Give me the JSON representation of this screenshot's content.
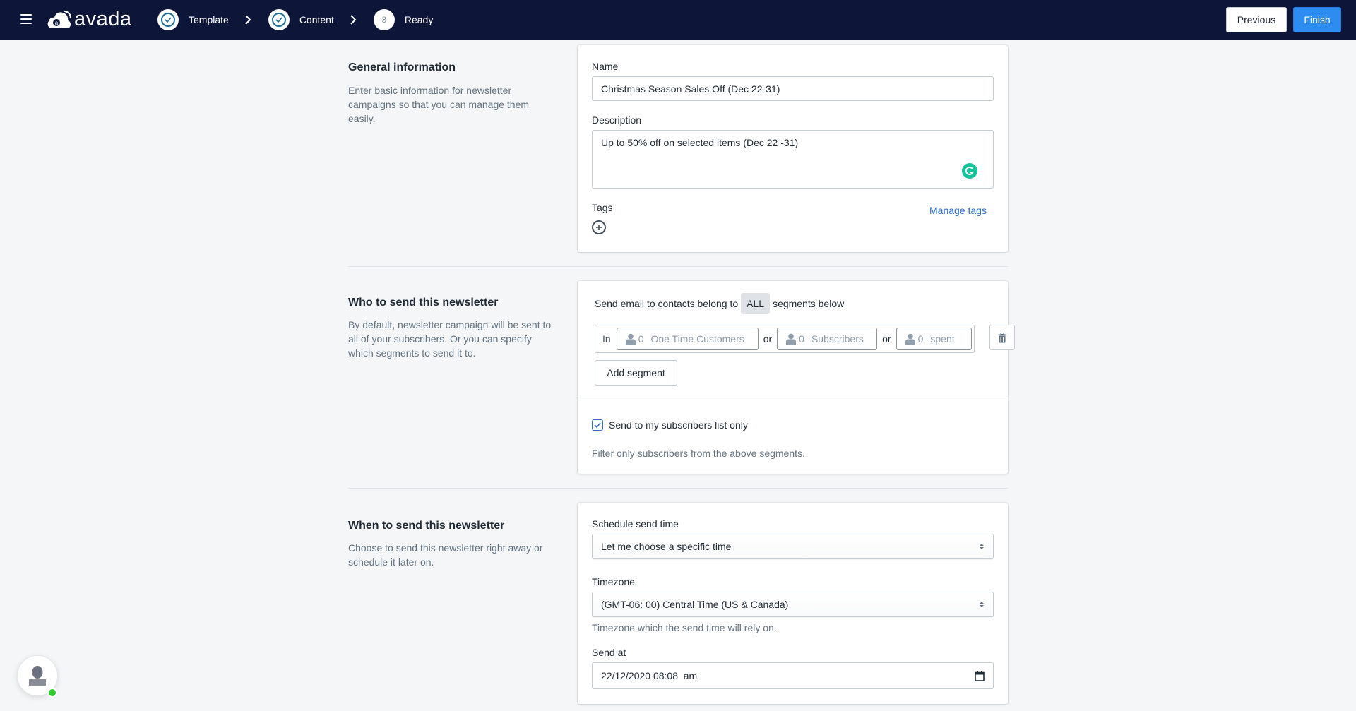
{
  "app": {
    "brand": "avada",
    "steps": [
      {
        "label": "Template",
        "state": "done"
      },
      {
        "label": "Content",
        "state": "done"
      },
      {
        "label": "Ready",
        "state": "current",
        "number": "3"
      }
    ],
    "previous_label": "Previous",
    "finish_label": "Finish"
  },
  "general": {
    "title": "General information",
    "description": "Enter basic information for newsletter campaigns so that you can manage them easily.",
    "name_label": "Name",
    "name_value": "Christmas Season Sales Off (Dec 22-31)",
    "description_label": "Description",
    "description_value": "Up to 50% off on selected items (Dec 22 -31)",
    "tags_label": "Tags",
    "manage_tags_label": "Manage tags"
  },
  "who": {
    "title": "Who to send this newsletter",
    "description": "By default, newsletter campaign will be sent to all of your subscribers. Or you can specify which segments to send it to.",
    "rule_prefix": "Send email to contacts belong to",
    "rule_match": "ALL",
    "rule_suffix": "segments below",
    "in_label": "In",
    "or_label": "or",
    "segments": [
      {
        "count": "0",
        "name": "One Time Customers"
      },
      {
        "count": "0",
        "name": "Subscribers"
      },
      {
        "count": "0",
        "name": "spent"
      }
    ],
    "add_segment_label": "Add segment",
    "subscribers_only_label": "Send to my subscribers list only",
    "subscribers_only_checked": true,
    "filter_help": "Filter only subscribers from the above segments."
  },
  "when": {
    "title": "When to send this newsletter",
    "description": "Choose to send this newsletter right away or schedule it later on.",
    "schedule_label": "Schedule send time",
    "schedule_value": "Let me choose a specific time",
    "timezone_label": "Timezone",
    "timezone_value": "(GMT-06: 00) Central Time (US & Canada)",
    "timezone_help": "Timezone which the send time will rely on.",
    "send_at_label": "Send at",
    "send_at_value": "22/12/2020 08:08  am"
  },
  "colors": {
    "topbar": "#0d1639",
    "primary": "#2c8cf0",
    "link": "#2c6ecb",
    "online": "#2ecc2e",
    "grammarly": "#15c39a"
  }
}
